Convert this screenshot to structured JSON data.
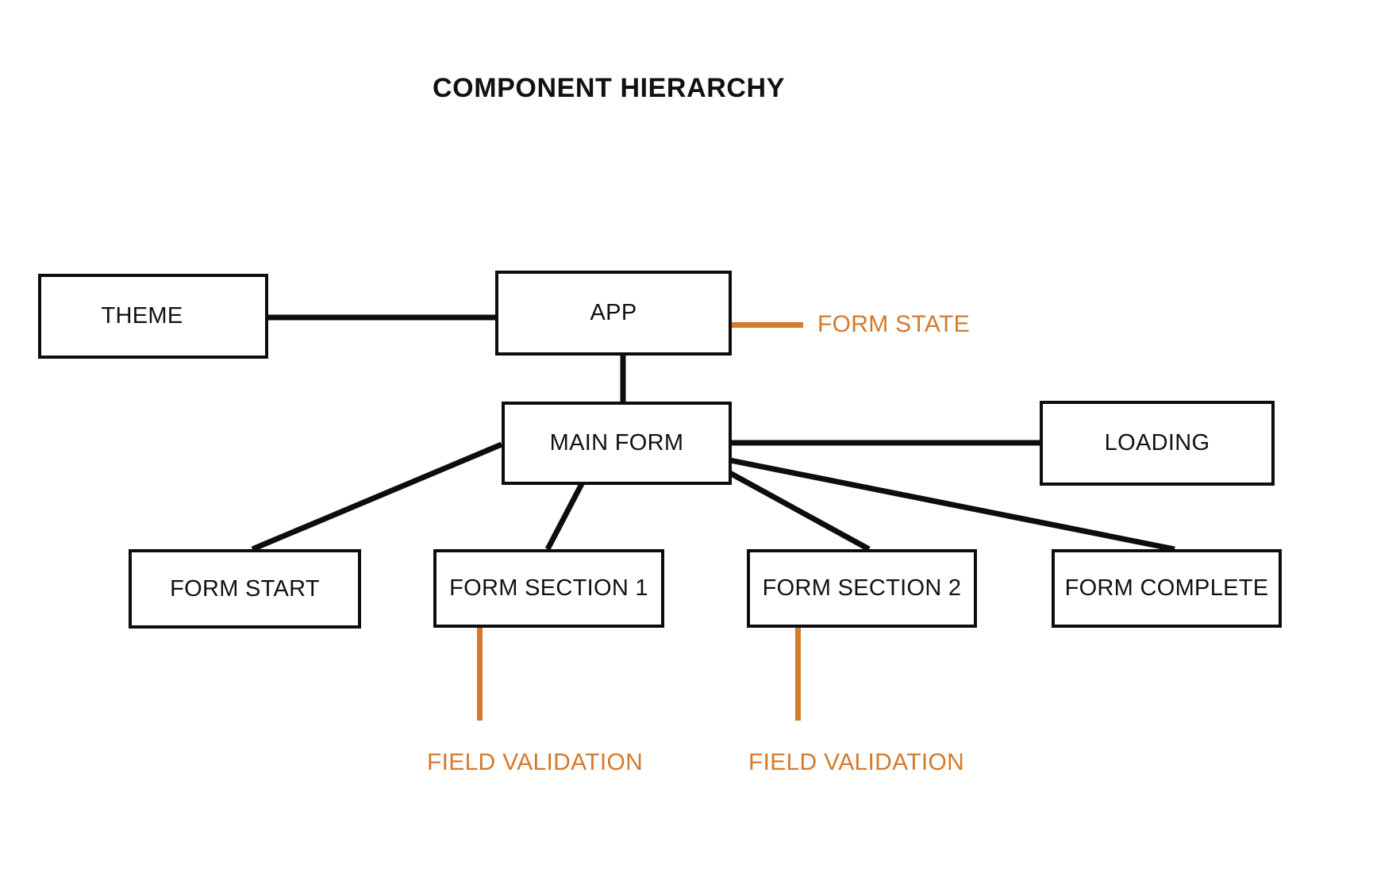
{
  "diagram": {
    "title": "COMPONENT HIERARCHY",
    "accent_color": "#d5792b",
    "line_color": "#0d0d0d",
    "background": "#ffffff"
  },
  "nodes": {
    "theme": {
      "label": "THEME"
    },
    "app": {
      "label": "APP"
    },
    "main_form": {
      "label": "MAIN FORM"
    },
    "loading": {
      "label": "LOADING"
    },
    "form_start": {
      "label": "FORM START"
    },
    "form_section_1": {
      "label": "FORM SECTION 1"
    },
    "form_section_2": {
      "label": "FORM SECTION 2"
    },
    "form_complete": {
      "label": "FORM COMPLETE"
    }
  },
  "annotations": {
    "form_state": {
      "label": "FORM STATE"
    },
    "field_validation_1": {
      "label": "FIELD VALIDATION"
    },
    "field_validation_2": {
      "label": "FIELD VALIDATION"
    }
  },
  "edges": [
    {
      "from": "theme",
      "to": "app",
      "style": "solid-black"
    },
    {
      "from": "app",
      "to": "main_form",
      "style": "solid-black"
    },
    {
      "from": "main_form",
      "to": "loading",
      "style": "solid-black"
    },
    {
      "from": "main_form",
      "to": "form_start",
      "style": "solid-black"
    },
    {
      "from": "main_form",
      "to": "form_section_1",
      "style": "solid-black"
    },
    {
      "from": "main_form",
      "to": "form_section_2",
      "style": "solid-black"
    },
    {
      "from": "main_form",
      "to": "form_complete",
      "style": "solid-black"
    },
    {
      "from": "app",
      "to": "form_state",
      "style": "solid-orange"
    },
    {
      "from": "form_section_1",
      "to": "field_validation_1",
      "style": "solid-orange"
    },
    {
      "from": "form_section_2",
      "to": "field_validation_2",
      "style": "solid-orange"
    }
  ]
}
